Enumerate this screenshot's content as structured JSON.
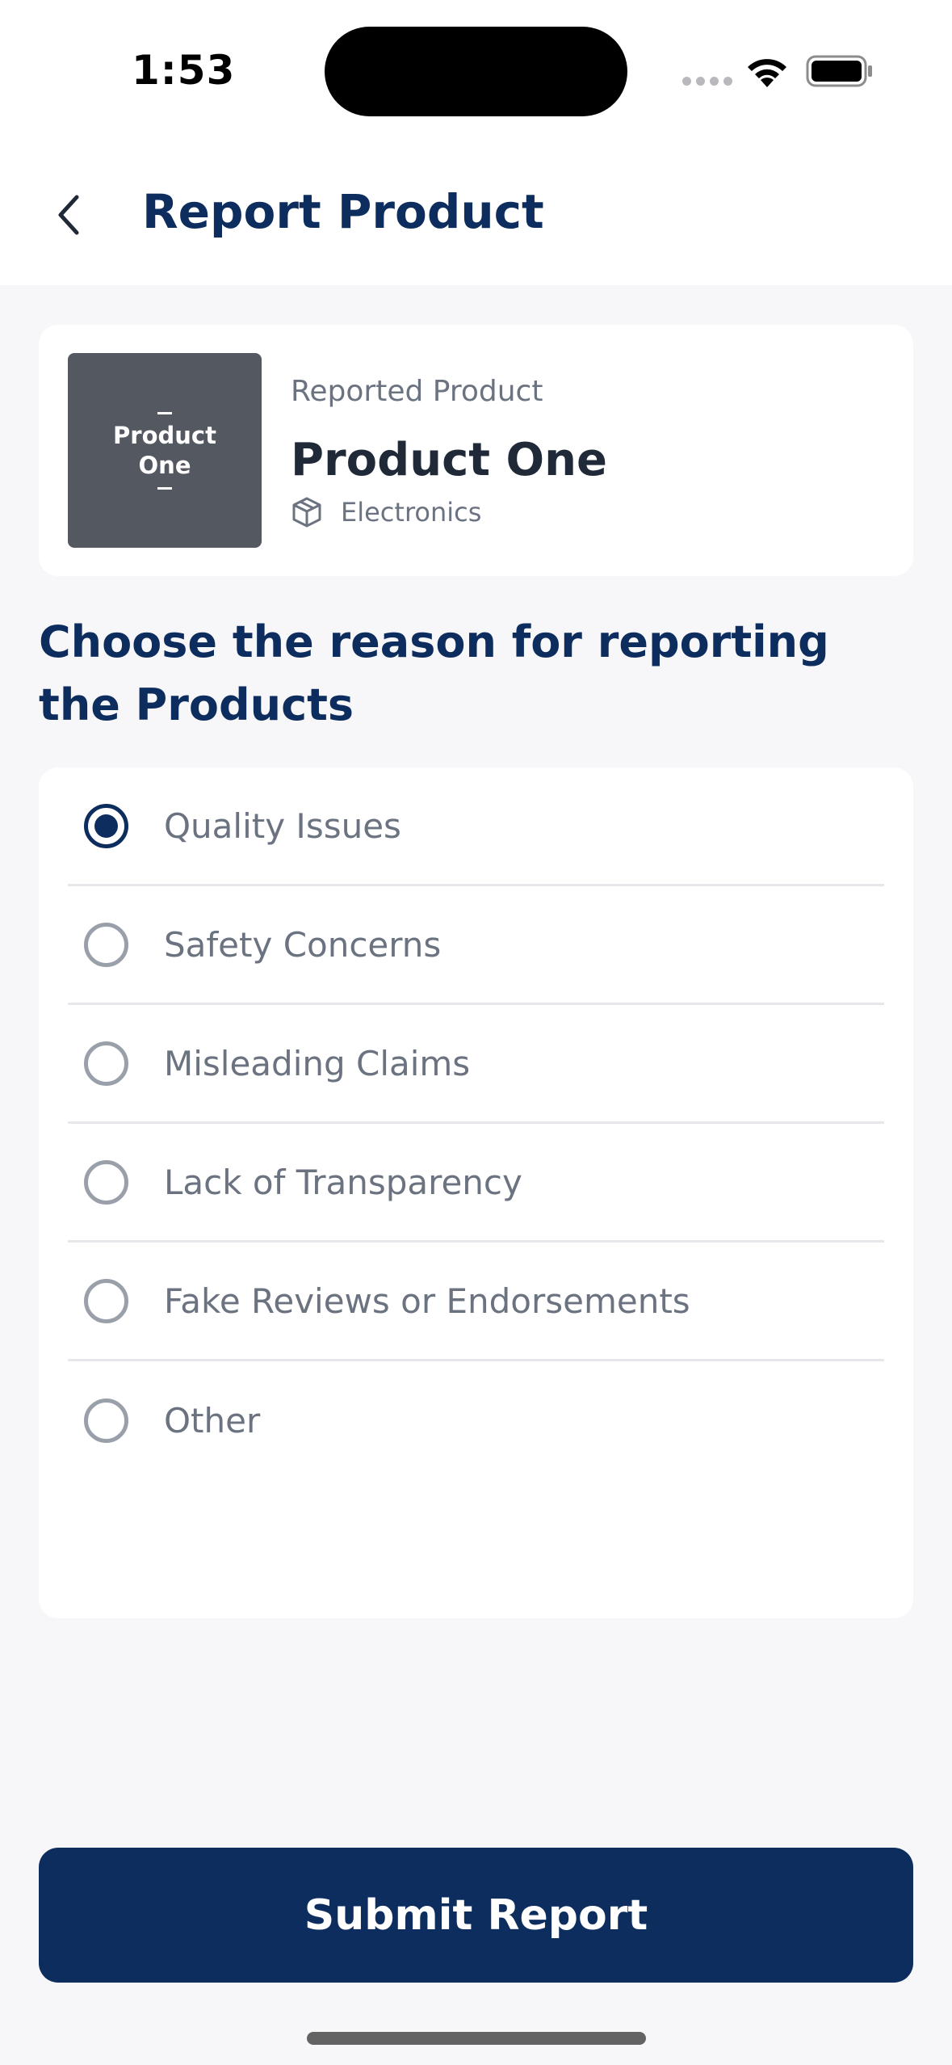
{
  "status_bar": {
    "time": "1:53"
  },
  "header": {
    "title": "Report Product"
  },
  "product": {
    "thumbnail_text": "Product One",
    "thumbnail_line1": "Product",
    "thumbnail_line2": "One",
    "reported_label": "Reported Product",
    "name": "Product One",
    "category": "Electronics",
    "category_icon": "package-icon"
  },
  "reasons": {
    "heading": "Choose the reason for reporting the Products",
    "selected": "Quality Issues",
    "items": [
      {
        "label": "Quality Issues",
        "selected": true
      },
      {
        "label": "Safety Concerns",
        "selected": false
      },
      {
        "label": "Misleading Claims",
        "selected": false
      },
      {
        "label": "Lack of Transparency",
        "selected": false
      },
      {
        "label": "Fake Reviews or Endorsements",
        "selected": false
      },
      {
        "label": "Other",
        "selected": false
      }
    ]
  },
  "actions": {
    "submit_label": "Submit Report"
  },
  "colors": {
    "primary": "#0d2d5e",
    "background": "#f7f7f9",
    "muted_text": "#6b7280"
  }
}
